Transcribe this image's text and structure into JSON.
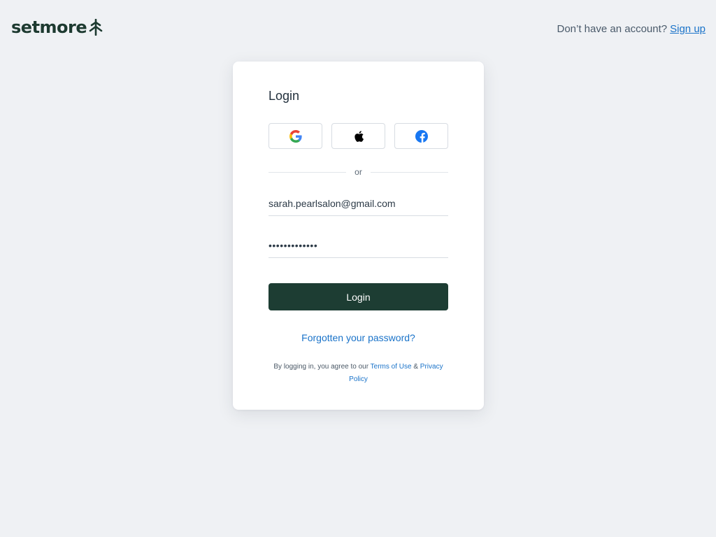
{
  "header": {
    "logo_text": "setmore",
    "signup_prompt": "Don’t have an account?",
    "signup_label": "Sign up"
  },
  "login": {
    "title": "Login",
    "social": [
      {
        "name": "google-icon"
      },
      {
        "name": "apple-icon"
      },
      {
        "name": "facebook-icon"
      }
    ],
    "divider_text": "or",
    "email_value": "sarah.pearlsalon@gmail.com",
    "password_value": "•••••••••••••",
    "login_button": "Login",
    "forgot_password": "Forgotten your password?",
    "legal_prefix": "By logging in, you agree to our",
    "terms_label": "Terms of Use",
    "legal_and": "&",
    "privacy_label": "Privacy Policy"
  },
  "colors": {
    "brand_dark": "#1d3d33",
    "link": "#1a73c9",
    "background": "#eff1f4"
  }
}
